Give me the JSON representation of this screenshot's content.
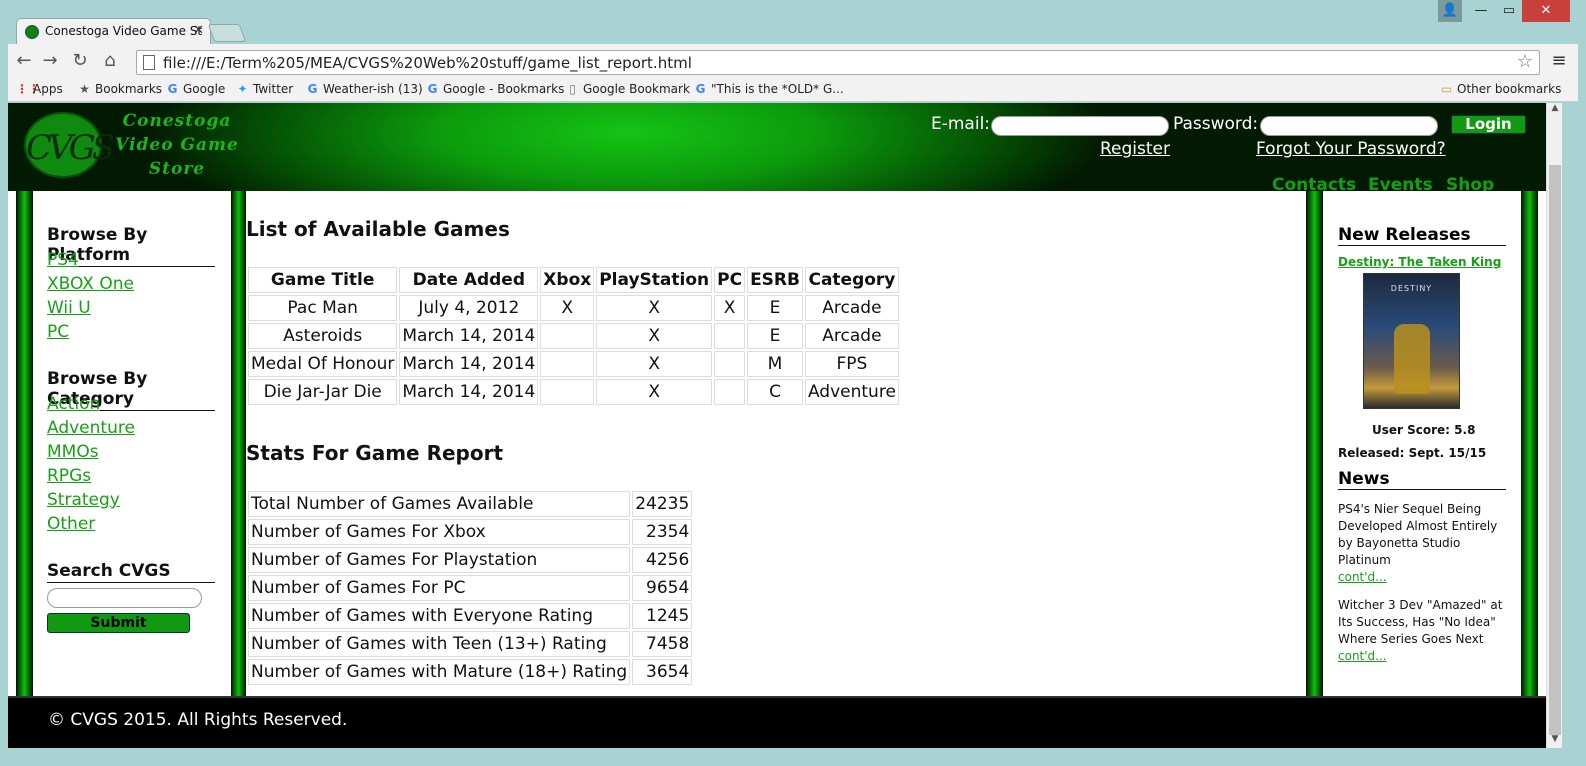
{
  "browser": {
    "tab_title": "Conestoga Video Game St",
    "url": "file:///E:/Term%205/MEA/CVGS%20Web%20stuff/game_list_report.html",
    "bookmarks": [
      "Apps",
      "Bookmarks",
      "Google",
      "Twitter",
      "Weather-ish (13)",
      "Google - Bookmarks",
      "Google Bookmark",
      "\"This is the *OLD* G...",
      "Other bookmarks"
    ]
  },
  "header": {
    "logo_letters": "CVGS",
    "logo_line1": "Conestoga",
    "logo_line2": "Video Game",
    "logo_line3": "Store",
    "email_label": "E-mail:",
    "password_label": "Password:",
    "login_label": "Login",
    "register_label": "Register",
    "forgot_label": "Forgot Your Password?",
    "nav": [
      "Contacts",
      "Events",
      "Shop"
    ]
  },
  "sidebar": {
    "platform_heading": "Browse By Platform",
    "platforms": [
      "PS4",
      "XBOX One",
      "Wii U",
      "PC"
    ],
    "category_heading": "Browse By Category",
    "categories": [
      "Action",
      "Adventure",
      "MMOs",
      "RPGs",
      "Strategy",
      "Other"
    ],
    "search_heading": "Search CVGS",
    "submit_label": "Submit"
  },
  "main": {
    "games_heading": "List of Available Games",
    "columns": [
      "Game Title",
      "Date Added",
      "Xbox",
      "PlayStation",
      "PC",
      "ESRB",
      "Category"
    ],
    "games": [
      [
        "Pac Man",
        "July 4, 2012",
        "X",
        "X",
        "X",
        "E",
        "Arcade"
      ],
      [
        "Asteroids",
        "March 14, 2014",
        "",
        "X",
        "",
        "E",
        "Arcade"
      ],
      [
        "Medal Of Honour",
        "March 14, 2014",
        "",
        "X",
        "",
        "M",
        "FPS"
      ],
      [
        "Die Jar-Jar Die",
        "March 14, 2014",
        "",
        "X",
        "",
        "C",
        "Adventure"
      ]
    ],
    "stats_heading": "Stats For Game Report",
    "stats": [
      [
        "Total Number of Games Available",
        "24235"
      ],
      [
        "Number of Games For Xbox",
        "2354"
      ],
      [
        "Number of Games For Playstation",
        "4256"
      ],
      [
        "Number of Games For PC",
        "9654"
      ],
      [
        "Number of Games with Everyone Rating",
        "1245"
      ],
      [
        "Number of Games with Teen (13+) Rating",
        "7458"
      ],
      [
        "Number of Games with Mature (18+) Rating",
        "3654"
      ]
    ]
  },
  "right": {
    "releases_heading": "New Releases",
    "release_title": "Destiny: The Taken King",
    "cover_text": "DESTINY",
    "user_score": "User Score: 5.8",
    "released": "Released: Sept. 15/15",
    "news_heading": "News",
    "news": [
      {
        "text": "PS4's Nier Sequel Being Developed Almost Entirely by Bayonetta Studio Platinum",
        "more": "cont'd..."
      },
      {
        "text": "Witcher 3 Dev \"Amazed\" at Its Success, Has \"No Idea\" Where Series Goes Next",
        "more": "cont'd..."
      }
    ]
  },
  "footer": {
    "copyright": "© CVGS 2015. All Rights Reserved."
  }
}
